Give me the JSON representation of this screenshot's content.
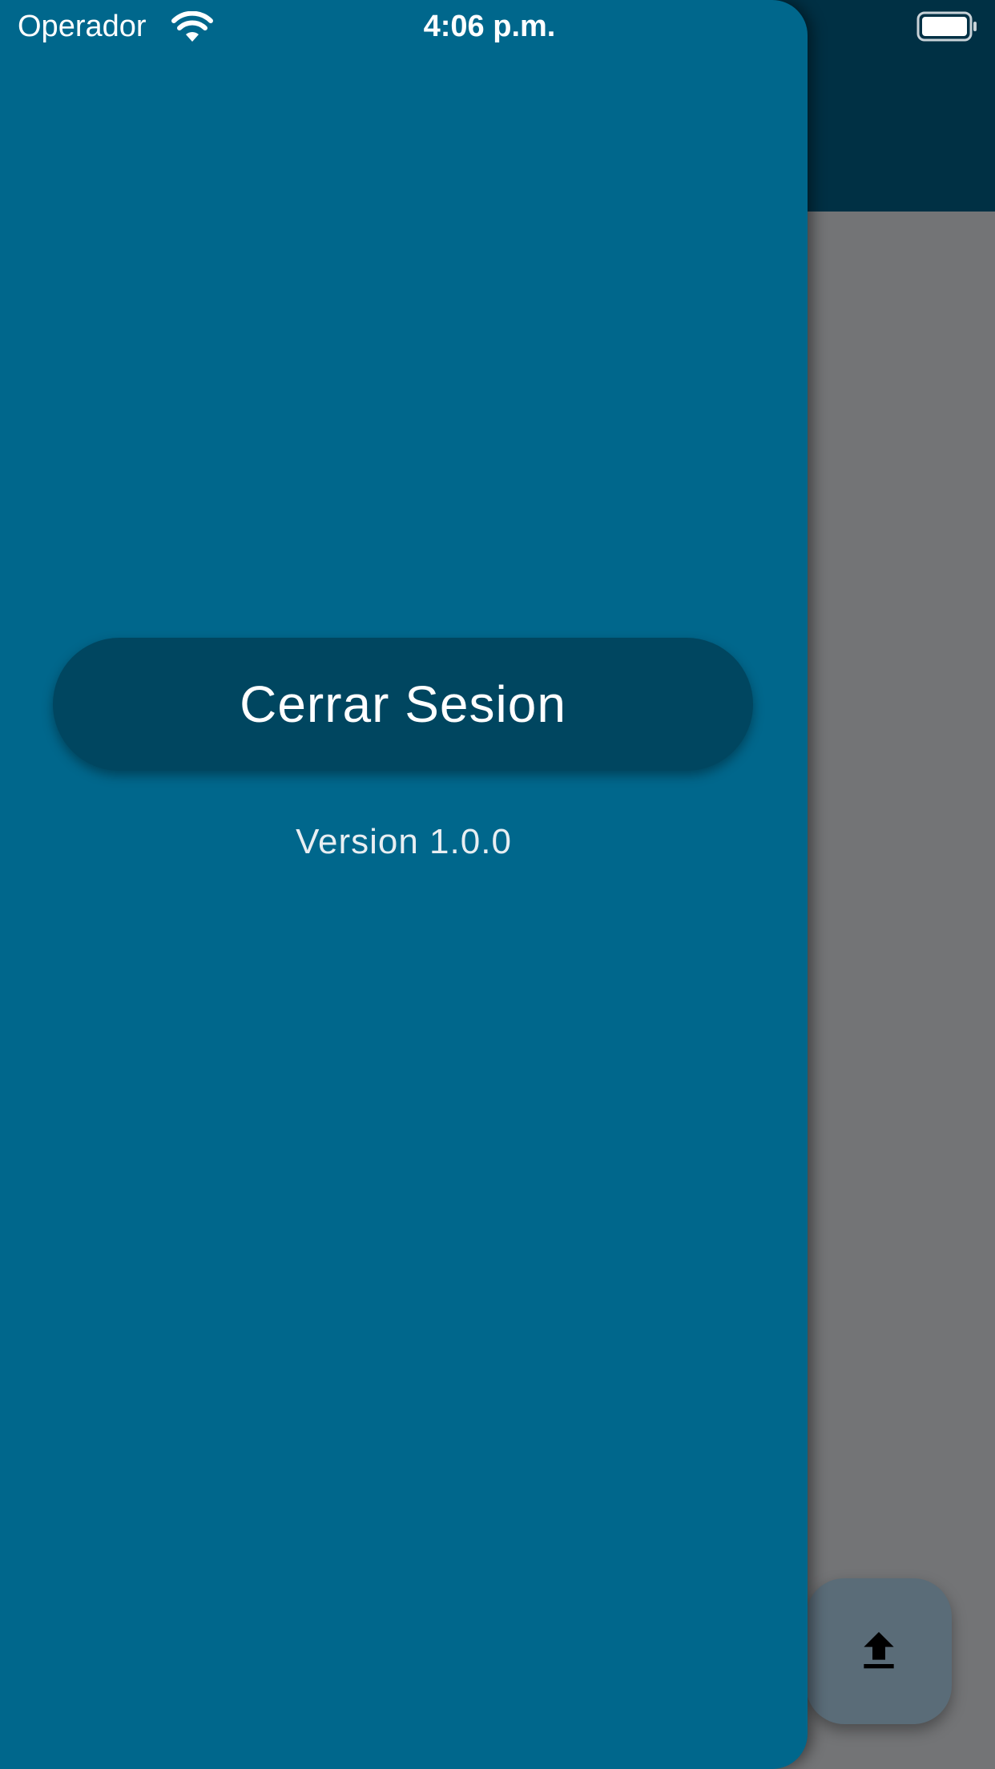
{
  "status_bar": {
    "carrier": "Operador",
    "time": "4:06 p.m."
  },
  "drawer": {
    "logout_label": "Cerrar Sesion",
    "version": "Version 1.0.0"
  },
  "fab": {
    "icon": "upload-icon"
  },
  "colors": {
    "drawer_bg": "#00678c",
    "button_bg": "#004660",
    "header_bg": "#003044",
    "scrim": "#737476",
    "fab_bg": "#5a6c78"
  }
}
